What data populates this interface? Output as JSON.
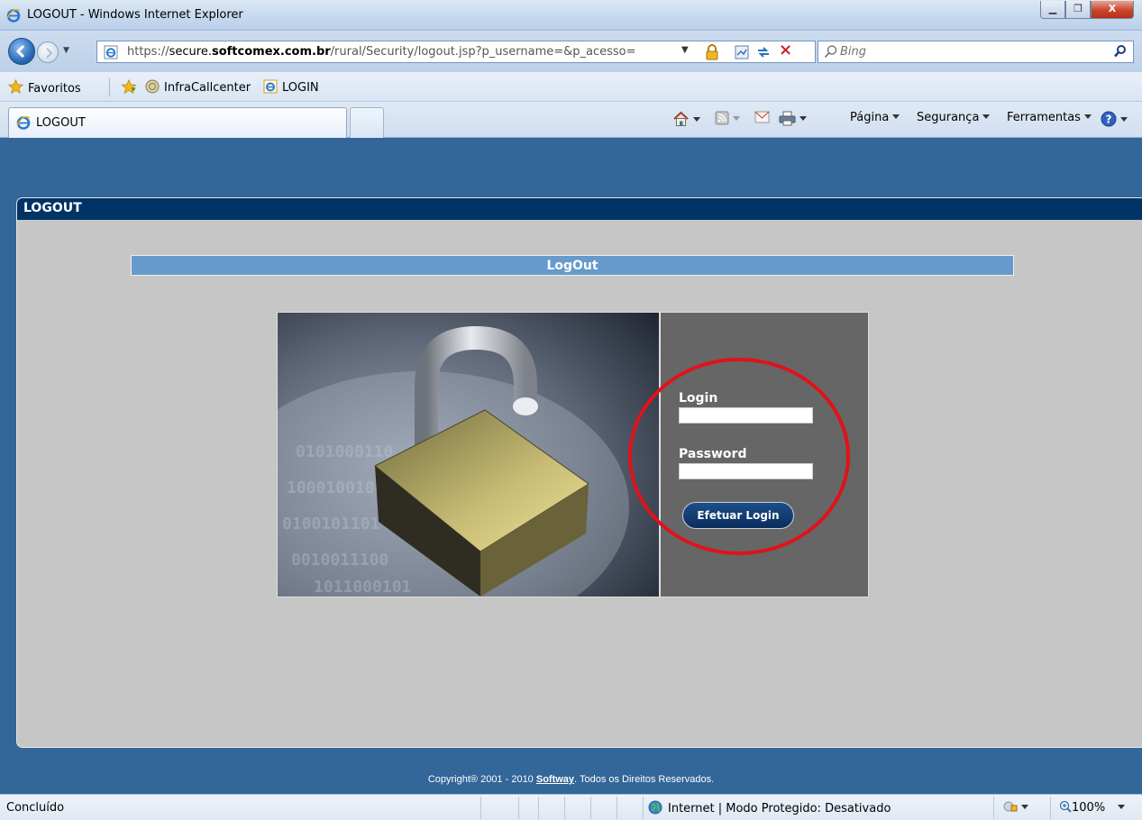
{
  "window": {
    "title": "LOGOUT - Windows Internet Explorer"
  },
  "address_bar": {
    "url_prefix": "https://",
    "url_host": "secure.",
    "url_domain": "softcomex.com.br",
    "url_path": "/rural/Security/logout.jsp?p_username=&p_acesso="
  },
  "search": {
    "placeholder": "Bing"
  },
  "favorites": {
    "label": "Favoritos",
    "items": [
      {
        "label": "InfraCallcenter",
        "icon": "web-slice-icon"
      },
      {
        "label": "LOGIN",
        "icon": "ie-page-icon"
      }
    ]
  },
  "tabs": [
    {
      "label": "LOGOUT",
      "active": true
    }
  ],
  "command_bar": {
    "page_label": "Página",
    "security_label": "Segurança",
    "tools_label": "Ferramentas"
  },
  "page": {
    "panel_title": "LOGOUT",
    "section_title": "LogOut",
    "login_label": "Login",
    "login_value": "",
    "password_label": "Password",
    "password_value": "",
    "submit_label": "Efetuar Login",
    "footer_prefix": "Copyright® 2001 - 2010 ",
    "footer_link": "Softway",
    "footer_suffix": ". Todos os Direitos Reservados."
  },
  "status_bar": {
    "status": "Concluído",
    "zone": "Internet | Modo Protegido: Desativado",
    "zoom": "100%"
  },
  "colors": {
    "page_background": "#336699",
    "panel_header": "#003366",
    "section_bar": "#6699cc",
    "login_panel": "#666666",
    "annotation_circle": "#e0121a"
  }
}
